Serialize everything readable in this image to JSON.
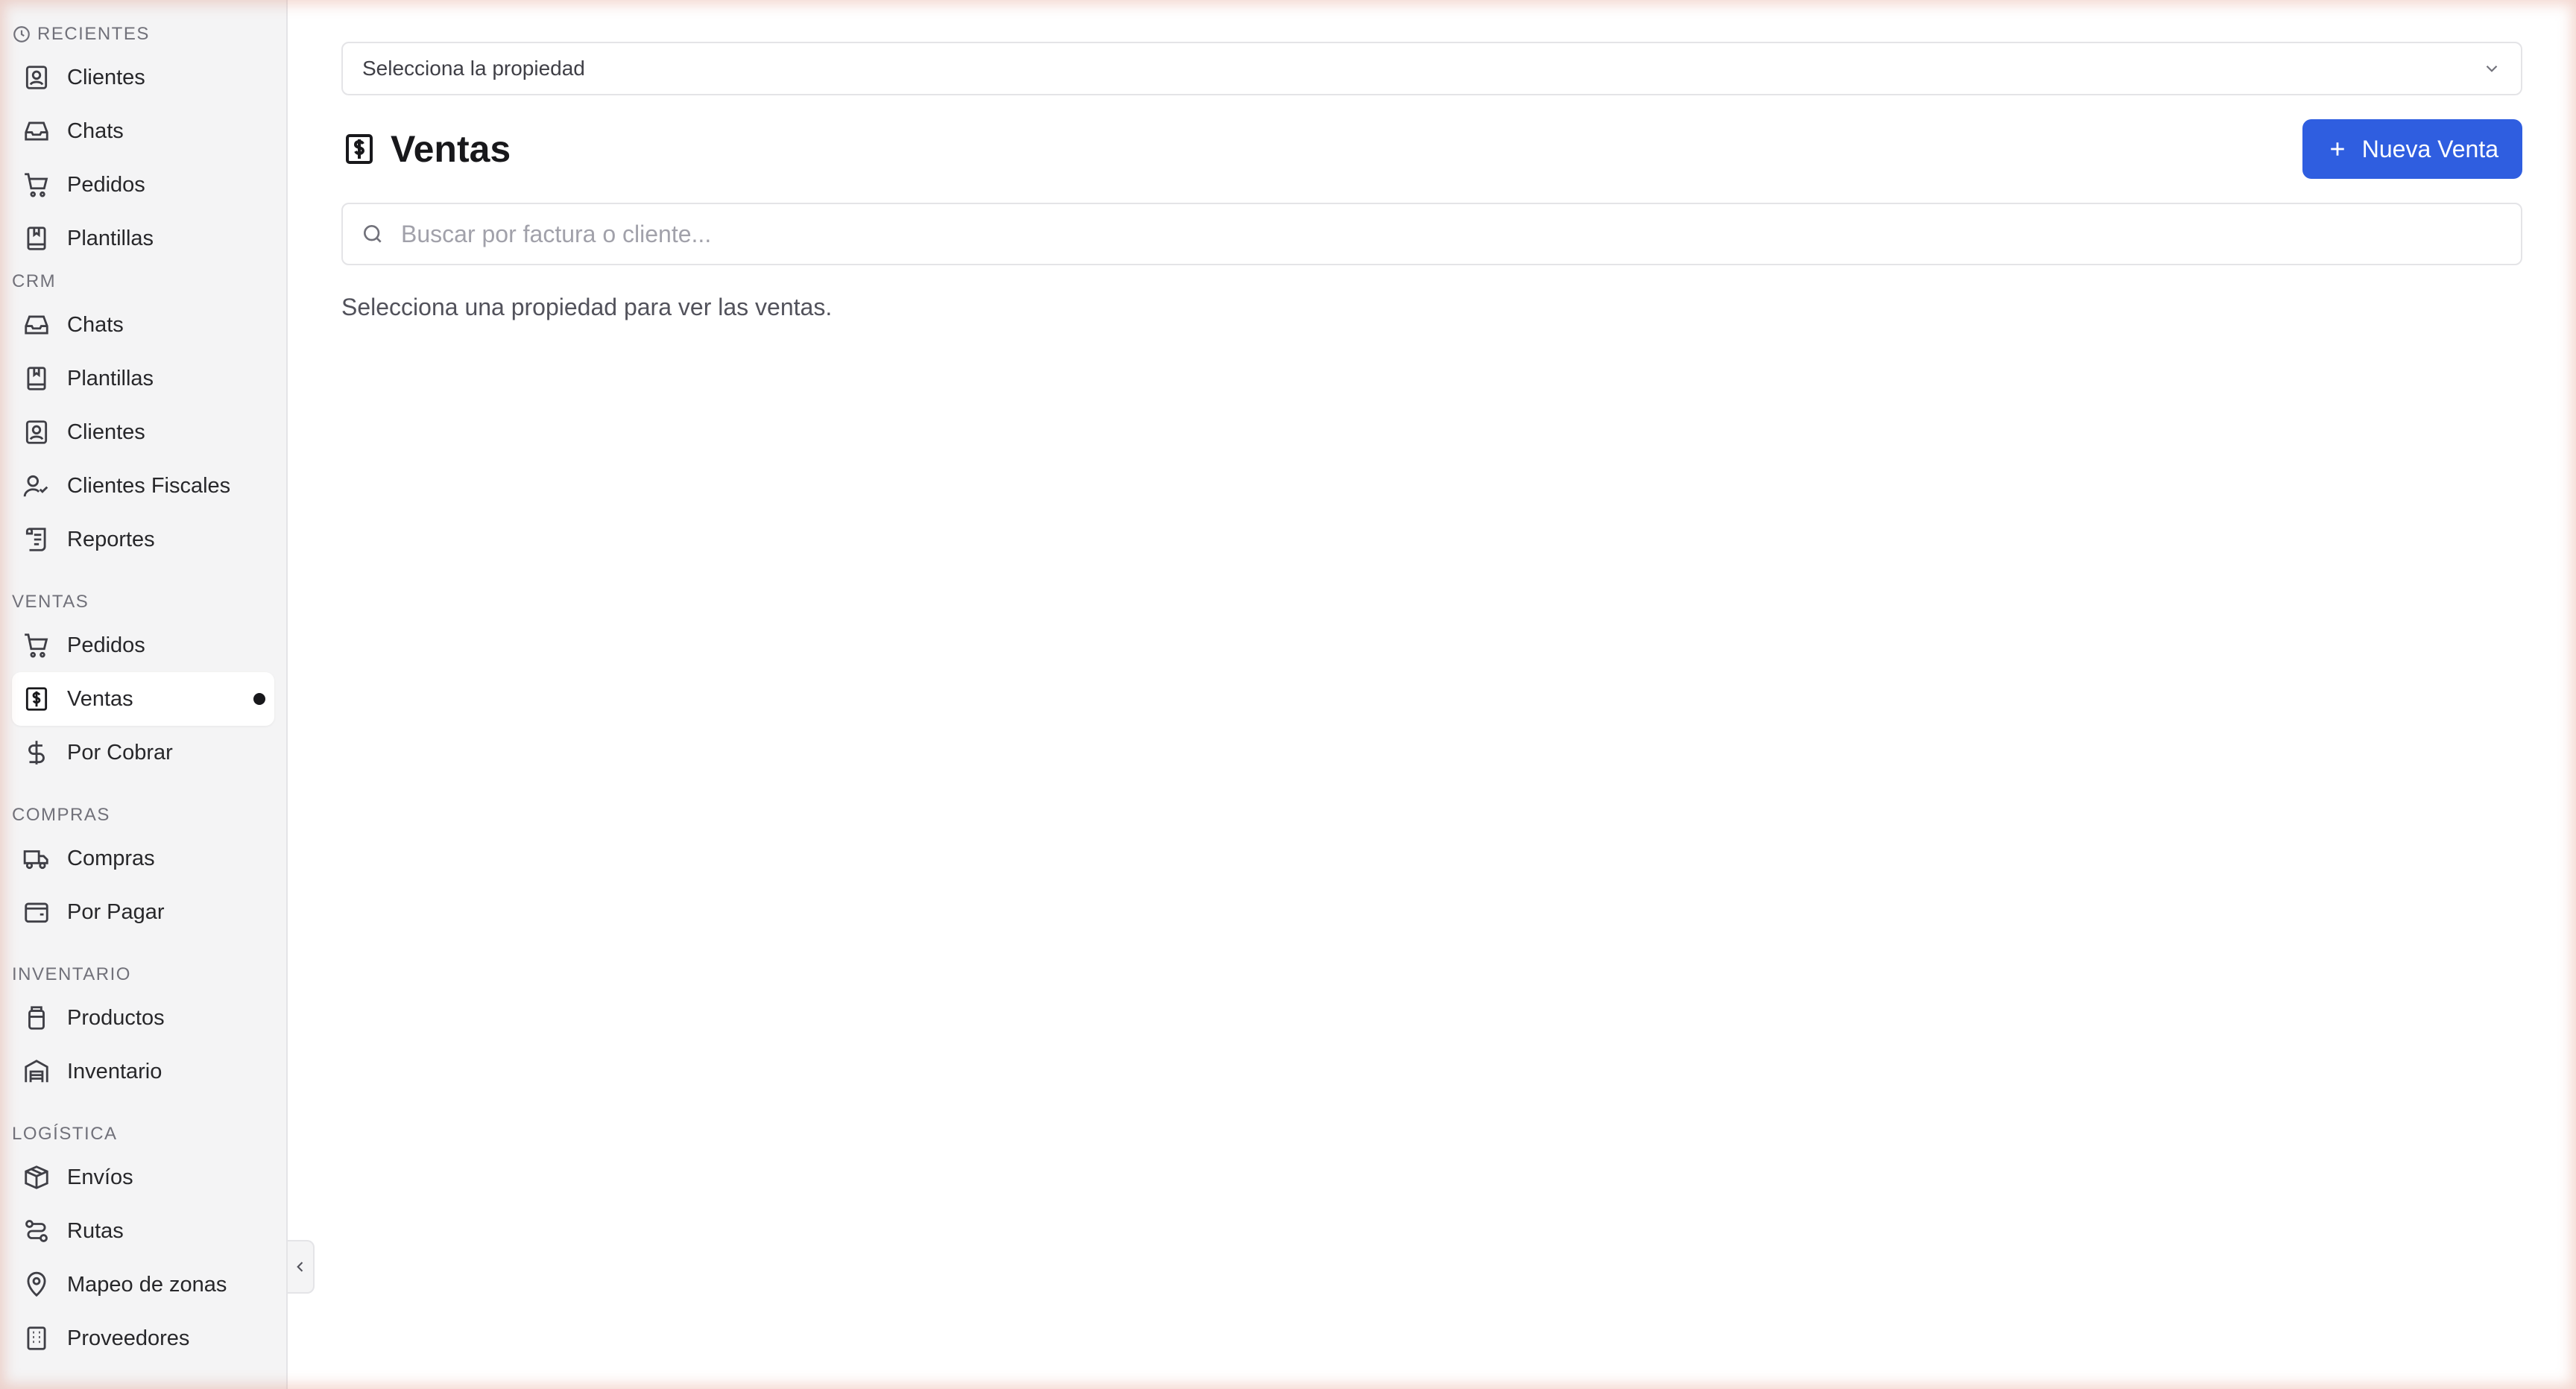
{
  "sidebar": {
    "sections": [
      {
        "label": "RECIENTES",
        "items": [
          {
            "label": "Clientes",
            "icon": "contact-icon"
          },
          {
            "label": "Chats",
            "icon": "inbox-icon"
          },
          {
            "label": "Pedidos",
            "icon": "cart-icon"
          },
          {
            "label": "Plantillas",
            "icon": "book-icon"
          }
        ]
      },
      {
        "label": "CRM",
        "items": [
          {
            "label": "Chats",
            "icon": "inbox-icon"
          },
          {
            "label": "Plantillas",
            "icon": "book-icon"
          },
          {
            "label": "Clientes",
            "icon": "contact-icon"
          },
          {
            "label": "Clientes Fiscales",
            "icon": "user-check-icon"
          },
          {
            "label": "Reportes",
            "icon": "report-icon"
          }
        ]
      },
      {
        "label": "VENTAS",
        "items": [
          {
            "label": "Pedidos",
            "icon": "cart-icon"
          },
          {
            "label": "Ventas",
            "icon": "receipt-dollar-icon"
          },
          {
            "label": "Por Cobrar",
            "icon": "dollar-icon"
          }
        ]
      },
      {
        "label": "COMPRAS",
        "items": [
          {
            "label": "Compras",
            "icon": "truck-icon"
          },
          {
            "label": "Por Pagar",
            "icon": "wallet-icon"
          }
        ]
      },
      {
        "label": "INVENTARIO",
        "items": [
          {
            "label": "Productos",
            "icon": "jar-icon"
          },
          {
            "label": "Inventario",
            "icon": "warehouse-icon"
          }
        ]
      },
      {
        "label": "LOGÍSTICA",
        "items": [
          {
            "label": "Envíos",
            "icon": "package-icon"
          },
          {
            "label": "Rutas",
            "icon": "route-icon"
          },
          {
            "label": "Mapeo de zonas",
            "icon": "map-pin-icon"
          },
          {
            "label": "Proveedores",
            "icon": "building-icon"
          }
        ]
      }
    ]
  },
  "main": {
    "property_select": {
      "value": "Selecciona la propiedad"
    },
    "page_title": "Ventas",
    "new_button_label": "Nueva Venta",
    "search": {
      "placeholder": "Buscar por factura o cliente..."
    },
    "empty_message": "Selecciona una propiedad para ver las ventas."
  },
  "colors": {
    "accent": "#2f5ee0",
    "sidebar_bg": "#f4f4f5"
  }
}
